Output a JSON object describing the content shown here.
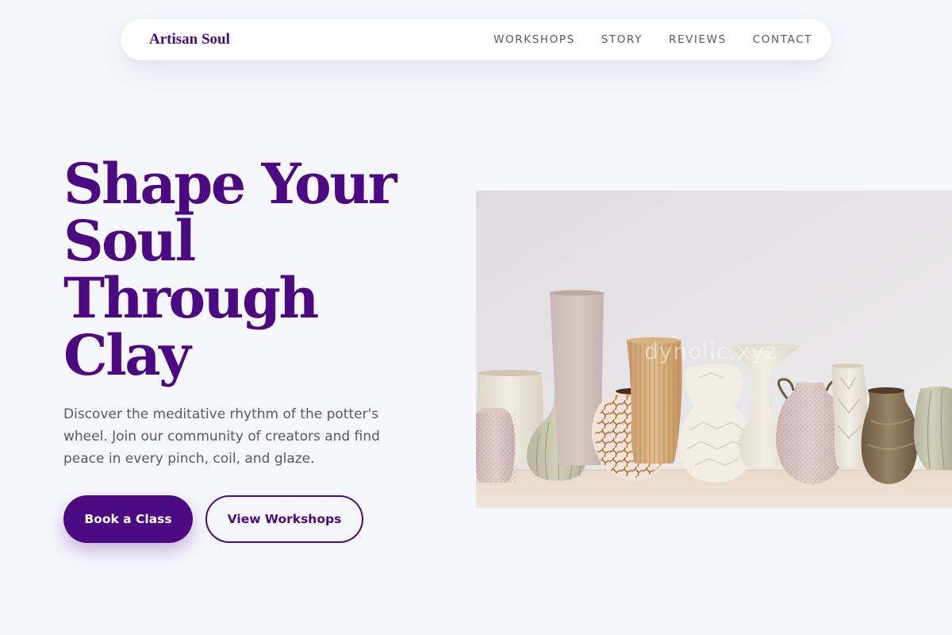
{
  "nav": {
    "brand": "Artisan Soul",
    "links": [
      "WORKSHOPS",
      "STORY",
      "REVIEWS",
      "CONTACT"
    ]
  },
  "hero": {
    "title_lines": [
      "Shape Your",
      "Soul",
      "Through",
      "Clay"
    ],
    "description": "Discover the meditative rhythm of the potter's wheel. Join our community of creators and find peace in every pinch, coil, and glaze.",
    "primary_button": "Book a Class",
    "secondary_button": "View Workshops",
    "image_watermark": "dynolic.xyz"
  },
  "colors": {
    "brand": "#4b0a82",
    "background": "#f6f7fd",
    "body_text": "#555a68",
    "nav_text": "#555a66"
  },
  "icons": []
}
